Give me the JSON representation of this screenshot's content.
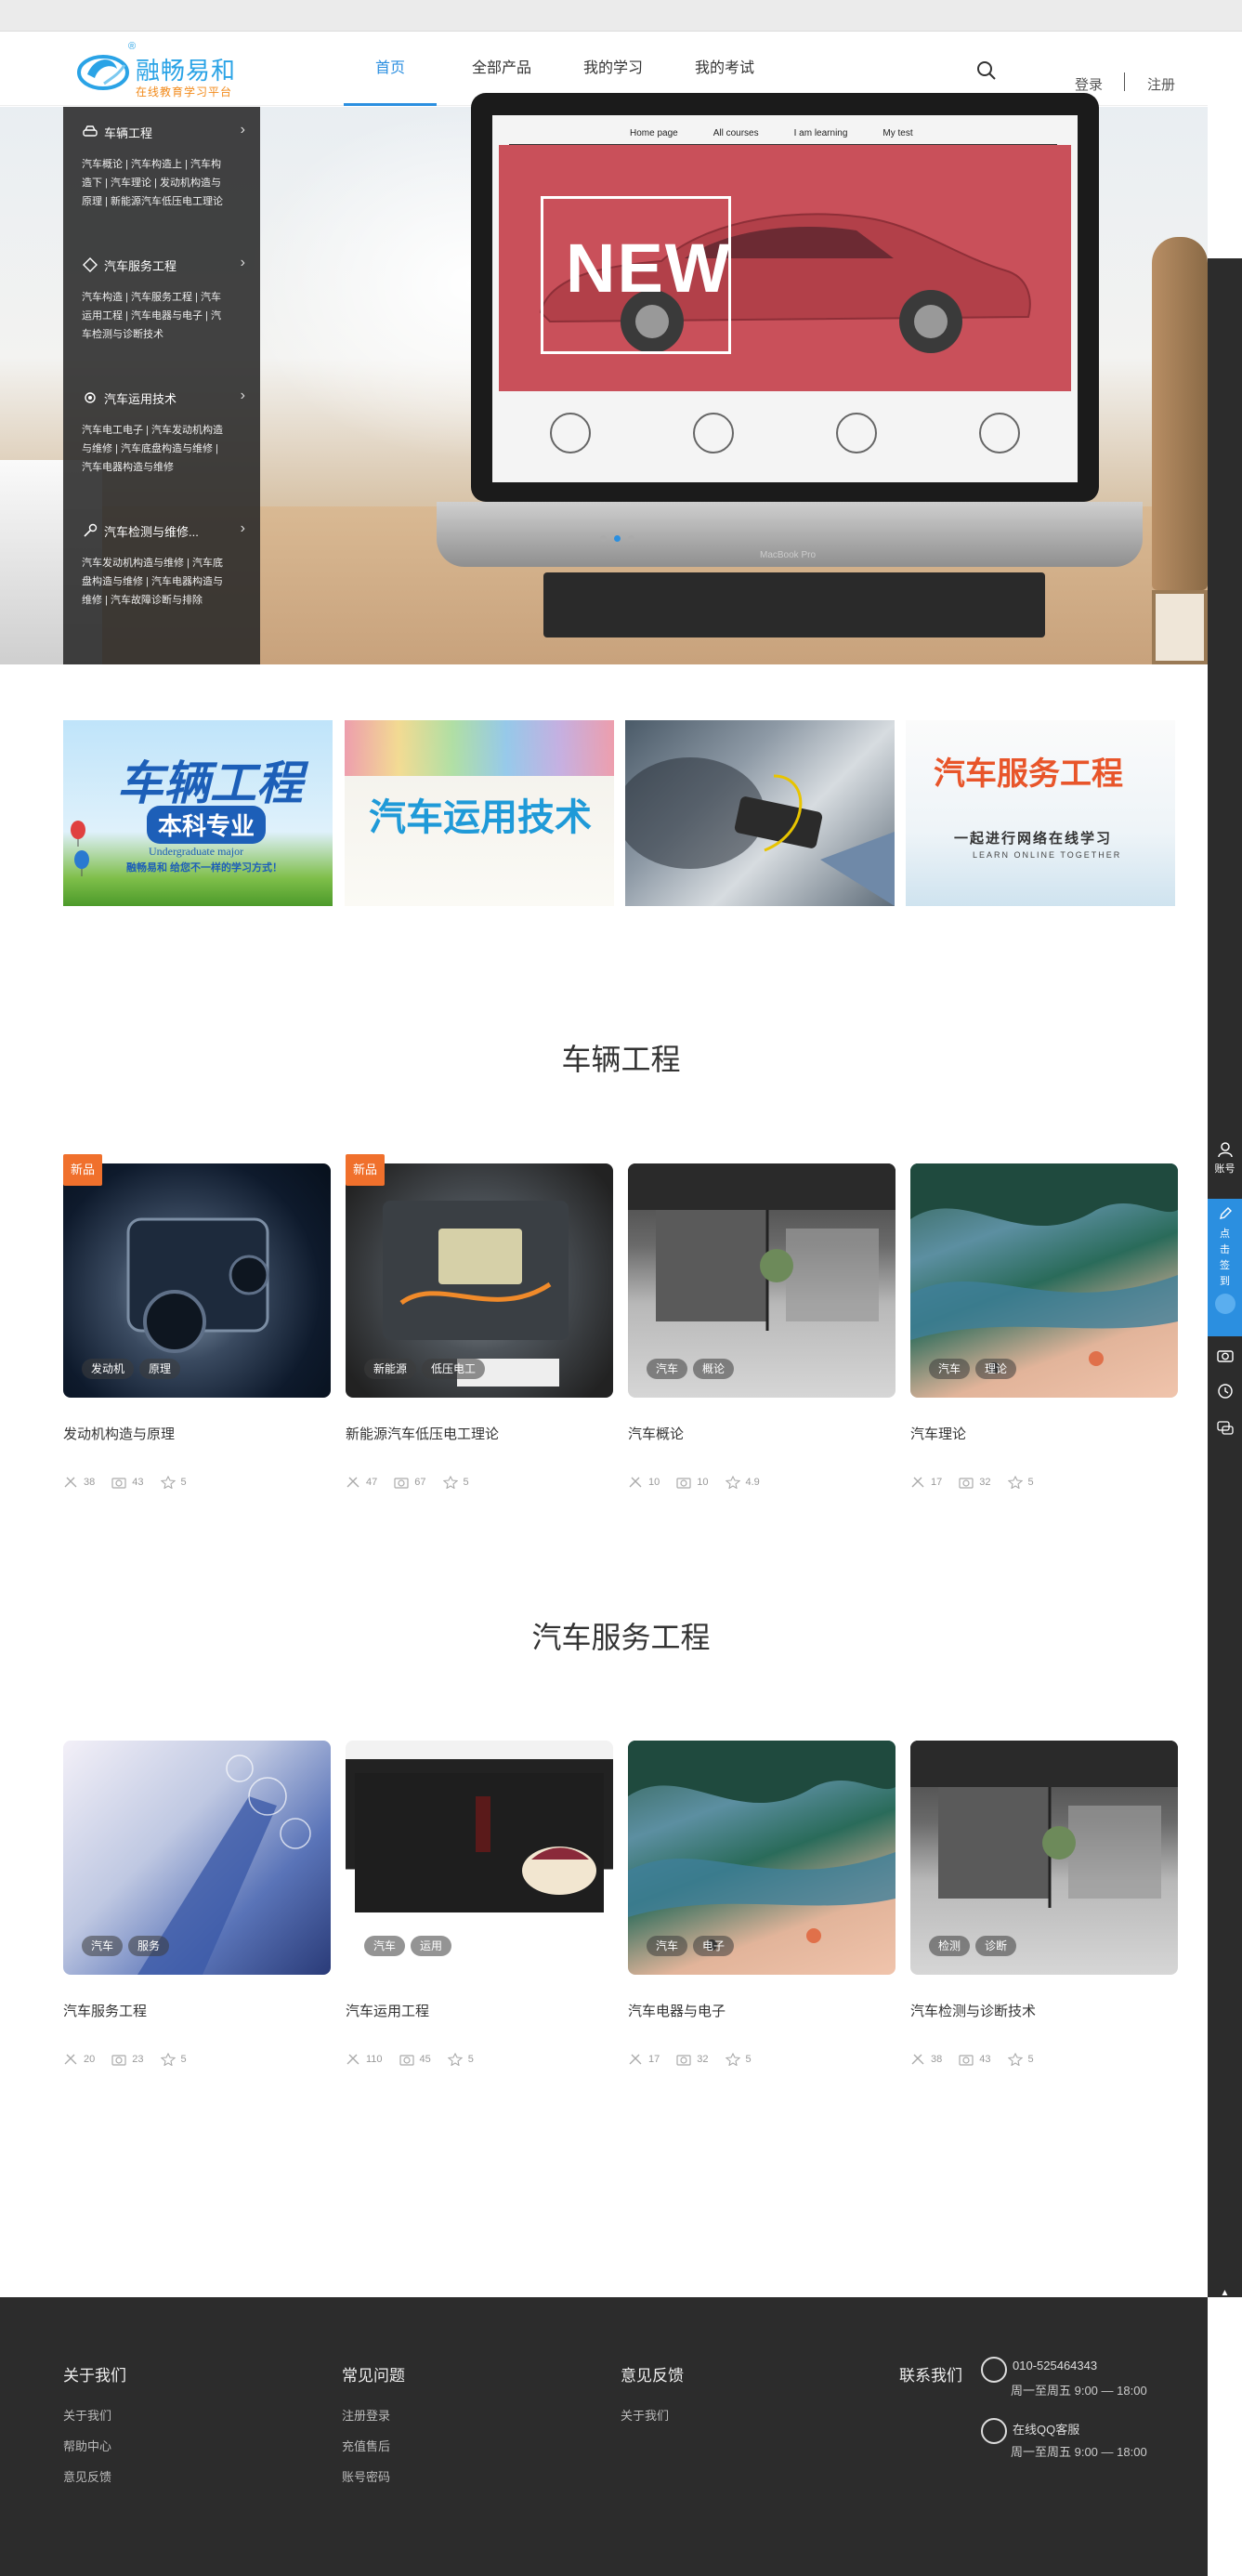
{
  "brand": {
    "name": "融畅易和",
    "tagline": "在线教育学习平台",
    "reg_mark": "®"
  },
  "nav": {
    "items": [
      {
        "label": "首页",
        "active": true
      },
      {
        "label": "全部产品",
        "active": false
      },
      {
        "label": "我的学习",
        "active": false
      },
      {
        "label": "我的考试",
        "active": false
      }
    ],
    "login": "登录",
    "register": "注册"
  },
  "category_menu": [
    {
      "title": "车辆工程",
      "icon": "car-icon",
      "subs": [
        "汽车概论 | 汽车构造上 | 汽车构",
        "造下 | 汽车理论 | 发动机构造与",
        "原理 | 新能源汽车低压电工理论"
      ]
    },
    {
      "title": "汽车服务工程",
      "icon": "diamond-icon",
      "subs": [
        "汽车构造 | 汽车服务工程 | 汽车",
        "运用工程 | 汽车电器与电子 | 汽",
        "车检测与诊断技术"
      ]
    },
    {
      "title": "汽车运用技术",
      "icon": "gear-icon",
      "subs": [
        "汽车电工电子 | 汽车发动机构造",
        "与维修 | 汽车底盘构造与维修 |",
        "汽车电器构造与维修"
      ]
    },
    {
      "title": "汽车检测与维修...",
      "icon": "wrench-icon",
      "subs": [
        "汽车发动机构造与维修 | 汽车底",
        "盘构造与维修 | 汽车电器构造与",
        "维修 | 汽车故障诊断与排除"
      ]
    }
  ],
  "banner": {
    "screen_nav": [
      "Home page",
      "All courses",
      "I am learning",
      "My test"
    ],
    "headline": "NEW",
    "laptop_label": "MacBook Pro",
    "dots": 3,
    "active_dot": 1
  },
  "promos": [
    {
      "title": "车辆工程",
      "sub": "本科专业",
      "en": "Undergraduate major",
      "slogan": "融畅易和  给您不一样的学习方式！"
    },
    {
      "title": "汽车运用技术",
      "sub": "",
      "en": "",
      "slogan": ""
    },
    {
      "title": "",
      "sub": "",
      "en": "",
      "slogan": ""
    },
    {
      "title": "汽车服务工程",
      "sub": "",
      "en": "LEARN ONLINE TOGETHER",
      "slogan": "一起进行网络在线学习"
    }
  ],
  "sections": [
    {
      "title": "车辆工程",
      "courses": [
        {
          "title": "发动机构造与原理",
          "badge": "新品",
          "tags": [
            "发动机",
            "原理"
          ],
          "tools": "38",
          "views": "43",
          "rating": "5"
        },
        {
          "title": "新能源汽车低压电工理论",
          "badge": "新品",
          "tags": [
            "新能源",
            "低压电工"
          ],
          "tools": "47",
          "views": "67",
          "rating": "5"
        },
        {
          "title": "汽车概论",
          "badge": "",
          "tags": [
            "汽车",
            "概论"
          ],
          "tools": "10",
          "views": "10",
          "rating": "4.9"
        },
        {
          "title": "汽车理论",
          "badge": "",
          "tags": [
            "汽车",
            "理论"
          ],
          "tools": "17",
          "views": "32",
          "rating": "5"
        }
      ]
    },
    {
      "title": "汽车服务工程",
      "courses": [
        {
          "title": "汽车服务工程",
          "badge": "",
          "tags": [
            "汽车",
            "服务"
          ],
          "tools": "20",
          "views": "23",
          "rating": "5"
        },
        {
          "title": "汽车运用工程",
          "badge": "",
          "tags": [
            "汽车",
            "运用"
          ],
          "tools": "110",
          "views": "45",
          "rating": "5"
        },
        {
          "title": "汽车电器与电子",
          "badge": "",
          "tags": [
            "汽车",
            "电子"
          ],
          "tools": "17",
          "views": "32",
          "rating": "5"
        },
        {
          "title": "汽车检测与诊断技术",
          "badge": "",
          "tags": [
            "检测",
            "诊断"
          ],
          "tools": "38",
          "views": "43",
          "rating": "5"
        }
      ]
    }
  ],
  "right_toolbar": {
    "account": "账号",
    "sign_in": [
      "点",
      "击",
      "签",
      "到"
    ],
    "top": "TOP"
  },
  "footer": {
    "cols": [
      {
        "title": "关于我们",
        "links": [
          "关于我们",
          "帮助中心",
          "意见反馈"
        ]
      },
      {
        "title": "常见问题",
        "links": [
          "注册登录",
          "充值售后",
          "账号密码"
        ]
      },
      {
        "title": "意见反馈",
        "links": [
          "关于我们"
        ]
      }
    ],
    "contact": {
      "title": "联系我们",
      "phone": "010-525464343",
      "phone_hours": "周一至周五 9:00 — 18:00",
      "qq": "在线QQ客服",
      "qq_hours": "周一至周五 9:00 — 18:00"
    }
  },
  "colors": {
    "accent": "#2b8fe0",
    "badge": "#f0702c",
    "footer_bg": "#2c2c2c"
  }
}
